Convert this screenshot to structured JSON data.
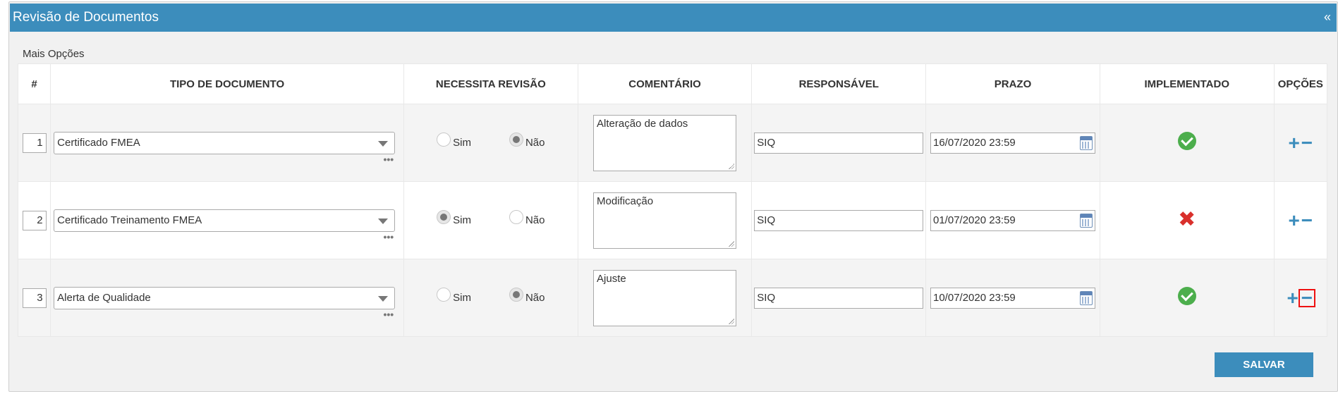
{
  "header": {
    "title": "Revisão de Documentos",
    "collapse_label": "«"
  },
  "mais_opcoes": "Mais Opções",
  "columns": [
    "#",
    "TIPO DE DOCUMENTO",
    "NECESSITA REVISÃO",
    "COMENTÁRIO",
    "RESPONSÁVEL",
    "PRAZO",
    "IMPLEMENTADO",
    "OPÇÕES"
  ],
  "radio_labels": {
    "sim": "Sim",
    "nao": "Não"
  },
  "select_more": "•••",
  "option_labels": {
    "add": "+",
    "remove": "−"
  },
  "rows": [
    {
      "num": "1",
      "tipo": "Certificado FMEA",
      "revisao": "nao",
      "comentario": "Alteração de dados",
      "responsavel": "SIQ",
      "prazo": "16/07/2020 23:59",
      "implementado": "ok"
    },
    {
      "num": "2",
      "tipo": "Certificado Treinamento FMEA",
      "revisao": "sim",
      "comentario": "Modificação",
      "responsavel": "SIQ",
      "prazo": "01/07/2020 23:59",
      "implementado": "x"
    },
    {
      "num": "3",
      "tipo": "Alerta de Qualidade",
      "revisao": "nao",
      "comentario": "Ajuste",
      "responsavel": "SIQ",
      "prazo": "10/07/2020 23:59",
      "implementado": "ok"
    }
  ],
  "save_label": "SALVAR",
  "colors": {
    "header": "#3c8dbc",
    "ok": "#4cae4c",
    "x": "#d9302c",
    "highlight": "#ee1111"
  }
}
